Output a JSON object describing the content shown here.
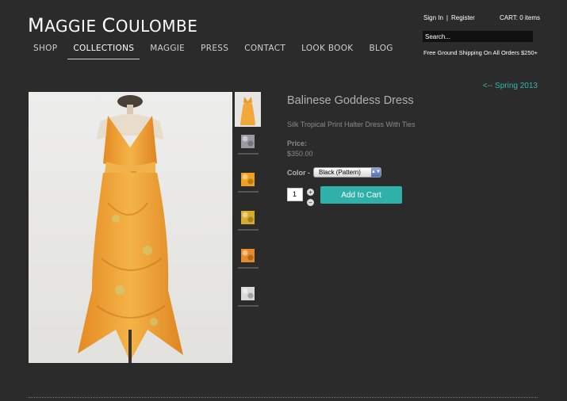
{
  "header": {
    "logo_text_1": "M",
    "logo_text_2": "AGGIE ",
    "logo_text_3": "C",
    "logo_text_4": "OULOMBE",
    "nav": [
      "SHOP",
      "COLLECTIONS",
      "MAGGIE",
      "PRESS",
      "CONTACT",
      "LOOK BOOK",
      "BLOG"
    ],
    "active_nav": "COLLECTIONS",
    "sign_in": "Sign In",
    "register": "Register",
    "separator": "|",
    "cart": "CART: 0 items",
    "search_placeholder": "Search...",
    "shipping": "Free Ground Shipping On All Orders $250+"
  },
  "product": {
    "back_link": "<-- Spring 2013",
    "title": "Balinese Goddess Dress",
    "subtitle": "Silk Tropical Print Halter Dress With Ties",
    "price_label": "Price:",
    "price": "$350.00",
    "color_label": "Color -",
    "color_selected": "Black (Pattern)",
    "quantity": "1",
    "plus": "+",
    "minus": "−",
    "add_to_cart": "Add to Cart"
  },
  "thumbnails": [
    {
      "kind": "dress-photo"
    },
    {
      "kind": "swatch",
      "color": "#9a9aa6"
    },
    {
      "kind": "swatch",
      "color": "#f2a11a"
    },
    {
      "kind": "swatch",
      "color": "#d8ac28"
    },
    {
      "kind": "swatch",
      "color": "#e98a2a"
    },
    {
      "kind": "swatch",
      "color": "#d9d9d9"
    }
  ],
  "colors": {
    "background": "#2b2b2b",
    "accent": "#2fb0a8",
    "dress": "#f0a034"
  }
}
